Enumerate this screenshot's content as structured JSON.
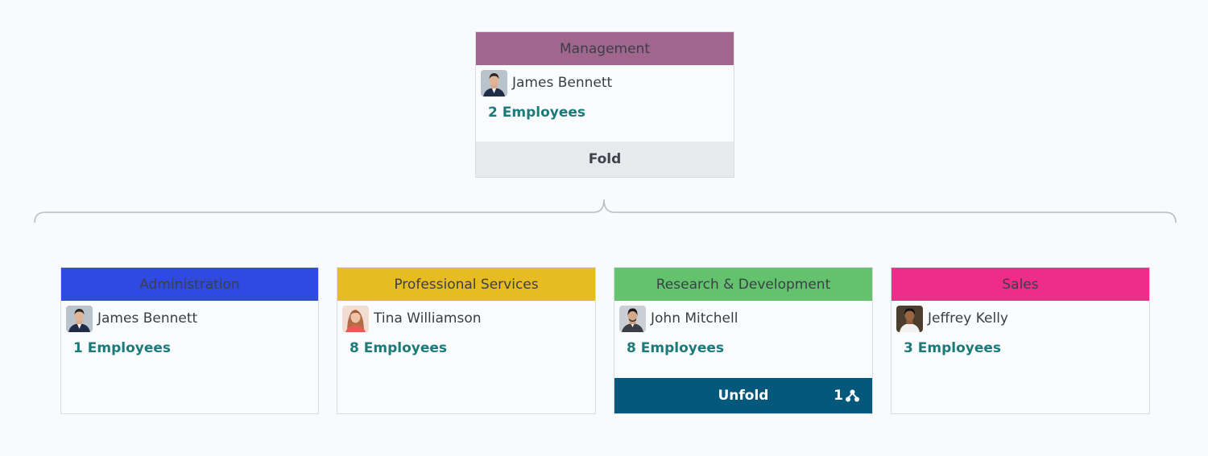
{
  "root": {
    "department": "Management",
    "header_color": "#a1668e",
    "manager": "James Bennett",
    "employees": "2 Employees",
    "fold_label": "Fold"
  },
  "children": [
    {
      "department": "Administration",
      "header_color": "#2f4ae0",
      "manager": "James Bennett",
      "employees": "1 Employees"
    },
    {
      "department": "Professional Services",
      "header_color": "#e7bc22",
      "manager": "Tina Williamson",
      "employees": "8 Employees"
    },
    {
      "department": "Research & Development",
      "header_color": "#64c26e",
      "manager": "John Mitchell",
      "employees": "8 Employees",
      "unfold_label": "Unfold",
      "sub_count": "1"
    },
    {
      "department": "Sales",
      "header_color": "#ee2d8b",
      "manager": "Jeffrey Kelly",
      "employees": "3 Employees"
    }
  ]
}
